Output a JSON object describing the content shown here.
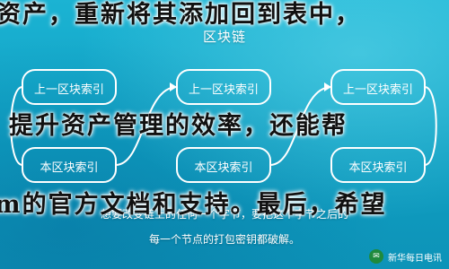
{
  "overlay": {
    "line1": "资产，重新将其添加回到表中，",
    "line2": "提升资产管理的效率，还能帮",
    "line3": "m的官方文档和支持。最后，希望"
  },
  "diagram": {
    "top_title": "区块链",
    "blocks": [
      {
        "top_label": "上一区块索引",
        "bottom_label": "本区块索引"
      },
      {
        "top_label": "上一区块索引",
        "bottom_label": "本区块索引"
      },
      {
        "top_label": "上一区块索引",
        "bottom_label": "本区块索引"
      }
    ],
    "caption_line1": "想要改变链上的任何一个字节，要把这个字节之后的",
    "caption_line2": "每一个节点的打包密钥都破解。"
  },
  "watermark": {
    "text": "新华每日电讯",
    "icon": "wechat-icon"
  },
  "colors": {
    "background": "#10a4c4",
    "block_fill": "#1aa9cc",
    "text": "#ffffff"
  }
}
